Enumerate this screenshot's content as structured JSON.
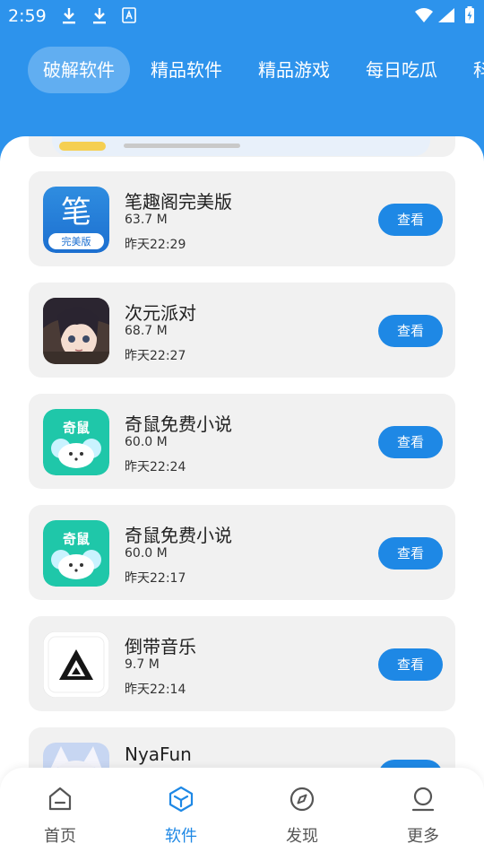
{
  "status_bar": {
    "time": "2:59"
  },
  "tabs": [
    {
      "label": "破解软件",
      "active": true
    },
    {
      "label": "精品软件",
      "active": false
    },
    {
      "label": "精品游戏",
      "active": false
    },
    {
      "label": "每日吃瓜",
      "active": false
    },
    {
      "label": "科",
      "active": false
    }
  ],
  "apps": [
    {
      "name": "笔趣阁完美版",
      "size": "63.7 M",
      "time": "昨天22:29",
      "button": "查看",
      "icon": "biquge-icon"
    },
    {
      "name": "次元派对",
      "size": "68.7 M",
      "time": "昨天22:27",
      "button": "查看",
      "icon": "ciyuan-icon"
    },
    {
      "name": "奇鼠免费小说",
      "size": "60.0 M",
      "time": "昨天22:24",
      "button": "查看",
      "icon": "qishu-icon"
    },
    {
      "name": "奇鼠免费小说",
      "size": "60.0 M",
      "time": "昨天22:17",
      "button": "查看",
      "icon": "qishu-icon"
    },
    {
      "name": "倒带音乐",
      "size": "9.7 M",
      "time": "昨天22:14",
      "button": "查看",
      "icon": "daodai-icon"
    },
    {
      "name": "NyaFun",
      "size": "",
      "time": "",
      "button": "查看",
      "icon": "nyafun-icon"
    }
  ],
  "icon_text": {
    "biquge_char": "笔",
    "biquge_sub": "完美版",
    "qishu_label": "奇鼠"
  },
  "bottom_nav": [
    {
      "label": "首页",
      "icon": "home-icon",
      "active": false
    },
    {
      "label": "软件",
      "icon": "box-icon",
      "active": true
    },
    {
      "label": "发现",
      "icon": "compass-icon",
      "active": false
    },
    {
      "label": "更多",
      "icon": "user-icon",
      "active": false
    }
  ],
  "colors": {
    "primary": "#2d93ec",
    "button": "#1e88e5",
    "card_bg": "#f1f1f1",
    "active_nav": "#1e88e5"
  }
}
